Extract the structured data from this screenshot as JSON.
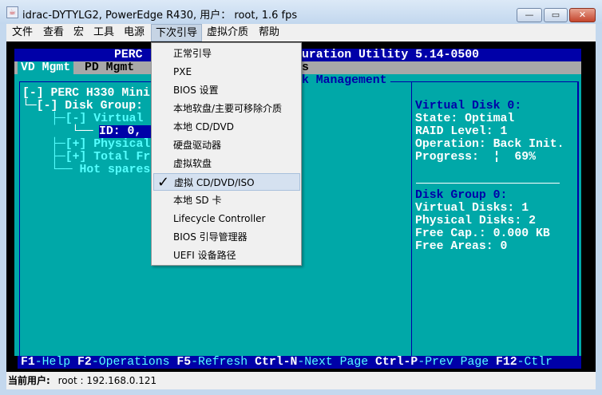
{
  "window": {
    "title": "idrac-DYTYLG2, PowerEdge R430, 用户： root, 1.6 fps",
    "minimize": "—",
    "maximize": "▭",
    "close": "✕"
  },
  "menubar": [
    "文件",
    "查看",
    "宏",
    "工具",
    "电源",
    "下次引导",
    "虚拟介质",
    "帮助"
  ],
  "boot_menu": {
    "items": [
      "正常引导",
      "PXE",
      "BIOS 设置",
      "本地软盘/主要可移除介质",
      "本地 CD/DVD",
      "硬盘驱动器",
      "虚拟软盘",
      "虚拟 CD/DVD/ISO",
      "本地 SD 卡",
      "Lifecycle Controller",
      "BIOS 引导管理器",
      "UEFI 设备路径"
    ],
    "checked": "虚拟 CD/DVD/ISO",
    "check": "✓"
  },
  "console": {
    "title_left": "PERC ",
    "title_right": "uration Utility 5.14-0500",
    "tabs": [
      "VD Mgmt",
      "PD Mgmt",
      "s"
    ],
    "panel_title": "k Management",
    "tree": [
      "[-] PERC H330 Mini",
      "└─[-] Disk Group:",
      "├─[-] Virtual",
      "└── ",
      "ID: 0,",
      "├─[+] Physical",
      "├─[+] Total Fr",
      "└── Hot spares"
    ],
    "vd": [
      "Virtual Disk 0:",
      "State: Optimal",
      "RAID Level: 1",
      "Operation: Back Init.",
      "Progress:  ¦  69%"
    ],
    "progress_percent": 69,
    "dg": [
      "Disk Group 0:",
      "Virtual Disks: 1",
      "Physical Disks: 2",
      "Free Cap.: 0.000 KB",
      "Free Areas: 0"
    ],
    "help": [
      [
        "F1",
        "-Help "
      ],
      [
        "F2",
        "-Operations "
      ],
      [
        "F5",
        "-Refresh "
      ],
      [
        "Ctrl-N",
        "-Next Page "
      ],
      [
        "Ctrl-P",
        "-Prev Page "
      ],
      [
        "F12",
        "-Ctlr"
      ]
    ]
  },
  "status": {
    "label": "当前用户:",
    "value": "root : 192.168.0.121"
  }
}
